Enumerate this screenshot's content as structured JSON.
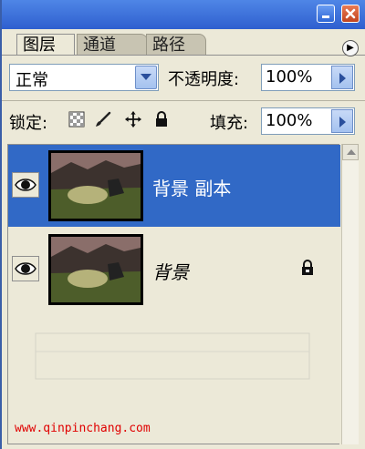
{
  "tabs": [
    {
      "label": "图层"
    },
    {
      "label": "通道"
    },
    {
      "label": "路径"
    }
  ],
  "blend_mode": {
    "value": "正常"
  },
  "opacity": {
    "label": "不透明度:",
    "value": "100%"
  },
  "lock": {
    "label": "锁定:"
  },
  "fill": {
    "label": "填充:",
    "value": "100%"
  },
  "layers": [
    {
      "name": "背景 副本",
      "selected": true,
      "visible": true
    },
    {
      "name": "背景",
      "selected": false,
      "visible": true,
      "locked": true
    }
  ],
  "footer": {
    "text": "www.qinpinchang.com"
  },
  "icons": {
    "minimize": "minimize-icon",
    "close": "close-icon",
    "panel_menu": "panel-menu-icon",
    "lock_transparency": "checkerboard-icon",
    "lock_pixels": "brush-icon",
    "lock_position": "move-icon",
    "lock_all": "lock-icon",
    "visibility": "eye-icon"
  },
  "colors": {
    "selection": "#3169c6",
    "panel": "#ece9d8",
    "titlebar": "#2f5fcf",
    "footer_text": "#e00000"
  }
}
